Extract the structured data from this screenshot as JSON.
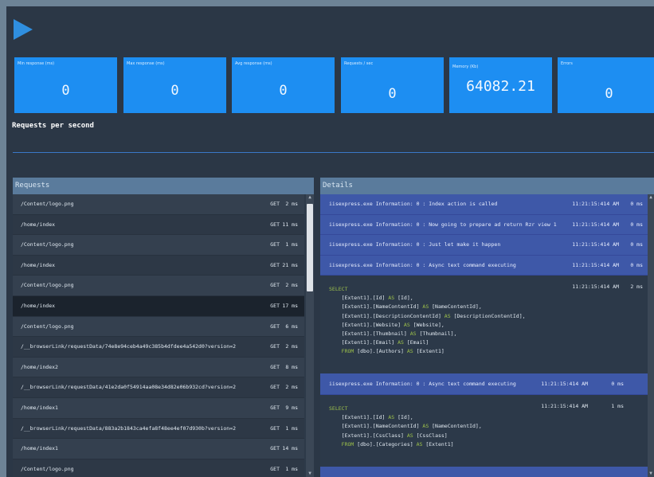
{
  "stats": [
    {
      "label": "Min response (ms)",
      "value": "0"
    },
    {
      "label": "Max response (ms)",
      "value": "0"
    },
    {
      "label": "Avg response (ms)",
      "value": "0"
    },
    {
      "label": "Requests / sec",
      "value": "0"
    },
    {
      "label": "Memory (Kb)",
      "value": "64082.21"
    },
    {
      "label": "Errors",
      "value": "0"
    }
  ],
  "rps_title": "Requests per second",
  "requests": {
    "title": "Requests",
    "rows": [
      {
        "path": "/Content/logo.png",
        "method": "GET",
        "ms": "2 ms"
      },
      {
        "path": "/home/index",
        "method": "GET",
        "ms": "11 ms"
      },
      {
        "path": "/Content/logo.png",
        "method": "GET",
        "ms": "1 ms"
      },
      {
        "path": "/home/index",
        "method": "GET",
        "ms": "21 ms"
      },
      {
        "path": "/Content/logo.png",
        "method": "GET",
        "ms": "2 ms"
      },
      {
        "path": "/home/index",
        "method": "GET",
        "ms": "17 ms"
      },
      {
        "path": "/Content/logo.png",
        "method": "GET",
        "ms": "6 ms"
      },
      {
        "path": "/__browserLink/requestData/74e8e94ceb4a49c385b4dfdee4a542d0?version=2",
        "method": "GET",
        "ms": "2 ms"
      },
      {
        "path": "/home/index2",
        "method": "GET",
        "ms": "8 ms"
      },
      {
        "path": "/__browserLink/requestData/41e2da0f54914aa08e34d82e06b932cd?version=2",
        "method": "GET",
        "ms": "2 ms"
      },
      {
        "path": "/home/index1",
        "method": "GET",
        "ms": "9 ms"
      },
      {
        "path": "/__browserLink/requestData/883a2b1843ca4efa8f48ee4ef07d930b?version=2",
        "method": "GET",
        "ms": "1 ms"
      },
      {
        "path": "/home/index1",
        "method": "GET",
        "ms": "14 ms"
      },
      {
        "path": "/Content/logo.png",
        "method": "GET",
        "ms": "1 ms"
      }
    ]
  },
  "details": {
    "title": "Details",
    "logs": [
      {
        "msg": "iisexpress.exe Information: 0 : Index action is called",
        "time": "11:21:15:414 AM",
        "ms": "0 ms"
      },
      {
        "msg": "iisexpress.exe Information: 0 : Now going to prepare ad return Rzr view 1",
        "time": "11:21:15:414 AM",
        "ms": "0 ms"
      },
      {
        "msg": "iisexpress.exe Information: 0 : Just let make it happen",
        "time": "11:21:15:414 AM",
        "ms": "0 ms"
      },
      {
        "msg": "iisexpress.exe Information: 0 : Async text command executing",
        "time": "11:21:15:414 AM",
        "ms": "0 ms"
      }
    ],
    "sql1": {
      "time": "11:21:15:414 AM",
      "ms": "2 ms",
      "lines": [
        "SELECT",
        "    [Extent1].[Id] AS [Id],",
        "    [Extent1].[NameContentId] AS [NameContentId],",
        "    [Extent1].[DescriptionContentId] AS [DescriptionContentId],",
        "    [Extent1].[Website] AS [Website],",
        "    [Extent1].[Thumbnail] AS [Thumbnail],",
        "    [Extent1].[Email] AS [Email]",
        "    FROM [dbo].[Authors] AS [Extent1]"
      ]
    },
    "log5": {
      "msg": "iisexpress.exe Information: 0 : Async text command executing",
      "time": "11:21:15:414 AM",
      "ms": "0 ms"
    },
    "sql2": {
      "time": "11:21:15:414 AM",
      "ms": "1 ms",
      "lines": [
        "SELECT",
        "    [Extent1].[Id] AS [Id],",
        "    [Extent1].[NameContentId] AS [NameContentId],",
        "    [Extent1].[CssClass] AS [CssClass]",
        "    FROM [dbo].[Categories] AS [Extent1]"
      ]
    }
  }
}
